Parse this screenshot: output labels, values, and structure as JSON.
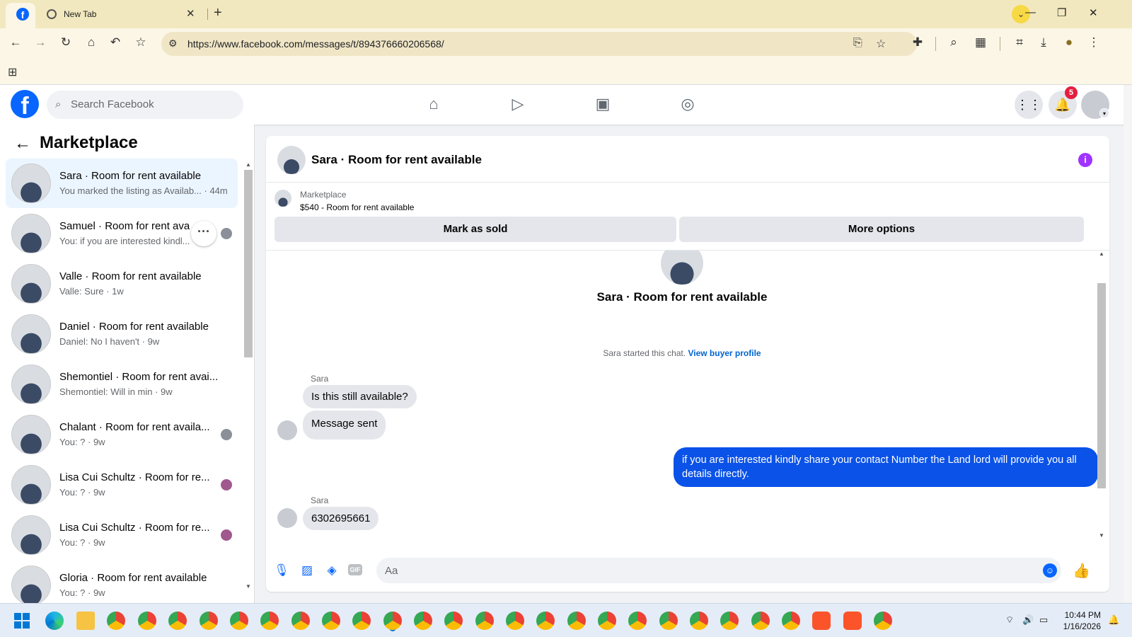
{
  "browser": {
    "tabs": [
      {
        "title": "",
        "icon": "facebook-favicon",
        "active": true
      },
      {
        "title": "New Tab",
        "icon": "globe-icon",
        "active": false
      }
    ],
    "url": "https://www.facebook.com/messages/t/894376660206568/"
  },
  "fb_header": {
    "search_placeholder": "Search Facebook",
    "notifications_count": "5"
  },
  "left_panel": {
    "title": "Marketplace",
    "conversations": [
      {
        "name": "Sara · Room for rent available",
        "snippet": "You marked the listing as Availab... · 44m",
        "active": true
      },
      {
        "name": "Samuel · Room for rent available",
        "snippet": "You: if you are interested kindl..."
      },
      {
        "name": "Valle · Room for rent available",
        "snippet": "Valle: Sure · 1w"
      },
      {
        "name": "Daniel · Room for rent available",
        "snippet": "Daniel: No I haven't · 9w"
      },
      {
        "name": "Shemontiel · Room for rent avai...",
        "snippet": "Shemontiel: Will in min · 9w"
      },
      {
        "name": "Chalant · Room for rent availa...",
        "snippet": "You: ? · 9w"
      },
      {
        "name": "Lisa Cui Schultz · Room for re...",
        "snippet": "You: ? · 9w"
      },
      {
        "name": "Lisa Cui Schultz · Room for re...",
        "snippet": "You: ? · 9w"
      },
      {
        "name": "Gloria · Room for rent available",
        "snippet": "You: ? · 9w"
      }
    ]
  },
  "chat": {
    "title": "Sara · Room for rent available",
    "listing": {
      "source": "Marketplace",
      "title": "$540 - Room for rent available",
      "mark_sold_label": "Mark as sold",
      "more_options_label": "More options"
    },
    "intro": {
      "title": "Sara · Room for rent available",
      "started_text": "Sara started this chat.",
      "profile_link": "View buyer profile"
    },
    "messages": [
      {
        "sender": "Sara",
        "text": "Is this still available?"
      },
      {
        "sender": "",
        "text": "Message sent"
      },
      {
        "sender": "You",
        "text": "if you are interested kindly share your contact Number the Land lord will provide you all details directly."
      },
      {
        "sender": "Sara",
        "text": "6302695661"
      }
    ],
    "composer_placeholder": "Aa"
  },
  "taskbar": {
    "time": "10:44 PM",
    "date": "1/16/2026"
  }
}
